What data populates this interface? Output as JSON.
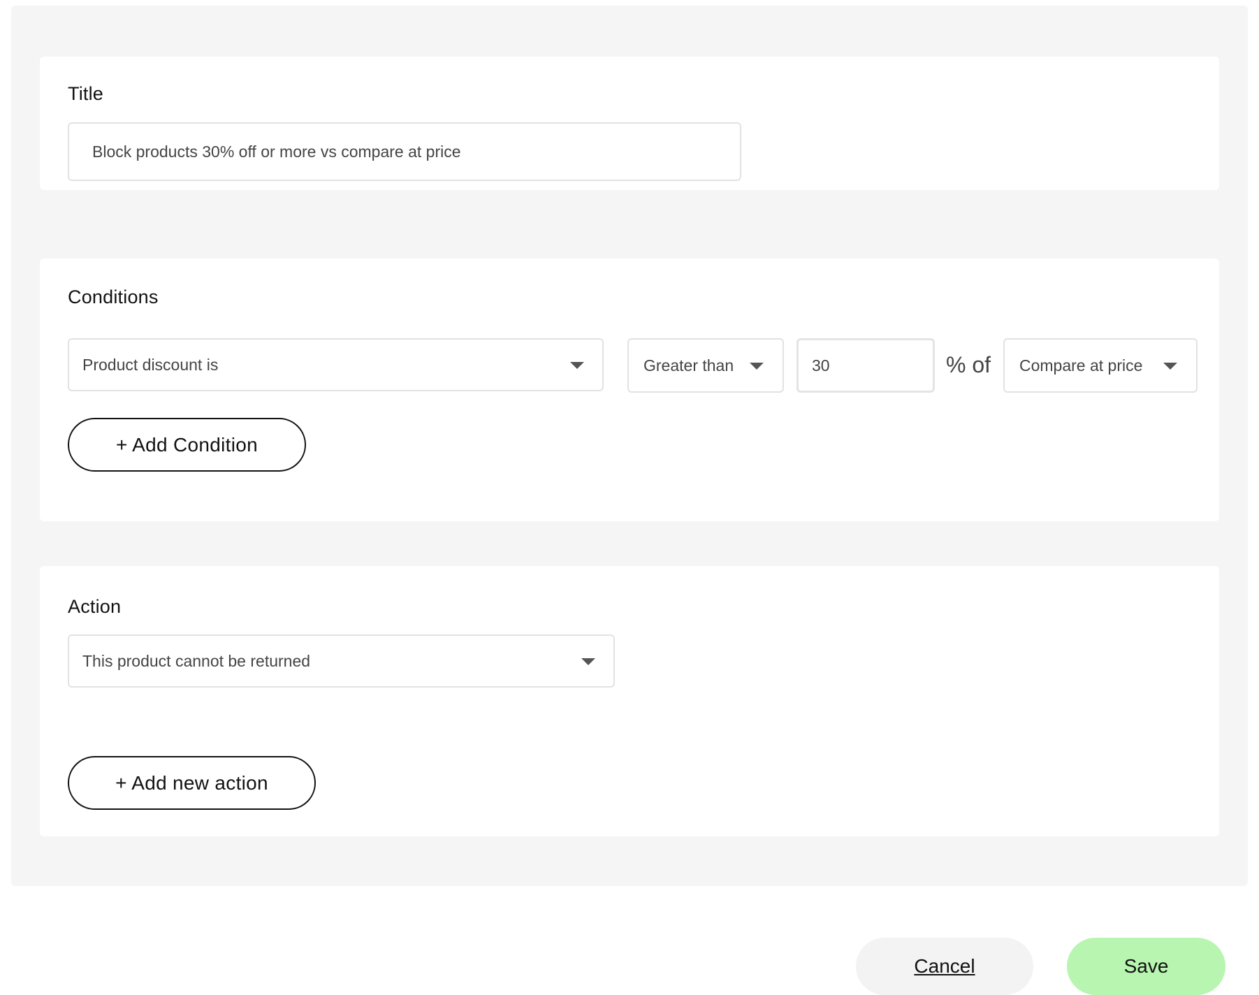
{
  "title_section": {
    "heading": "Title",
    "input_value": "Block products 30% off or more vs compare at price"
  },
  "conditions_section": {
    "heading": "Conditions",
    "field_select": "Product discount is",
    "operator_select": "Greater than",
    "value_input": "30",
    "unit_label": "% of",
    "reference_select": "Compare at price",
    "add_button": "+ Add Condition"
  },
  "action_section": {
    "heading": "Action",
    "action_select": "This product cannot be returned",
    "add_button": "+ Add new action"
  },
  "footer": {
    "cancel_label": "Cancel",
    "save_label": "Save"
  },
  "colors": {
    "page_background": "#f5f5f5",
    "card_background": "#ffffff",
    "save_button": "#b8f5b0",
    "cancel_button": "#f3f3f3"
  },
  "icons": {
    "dropdown": "chevron-down-icon"
  }
}
